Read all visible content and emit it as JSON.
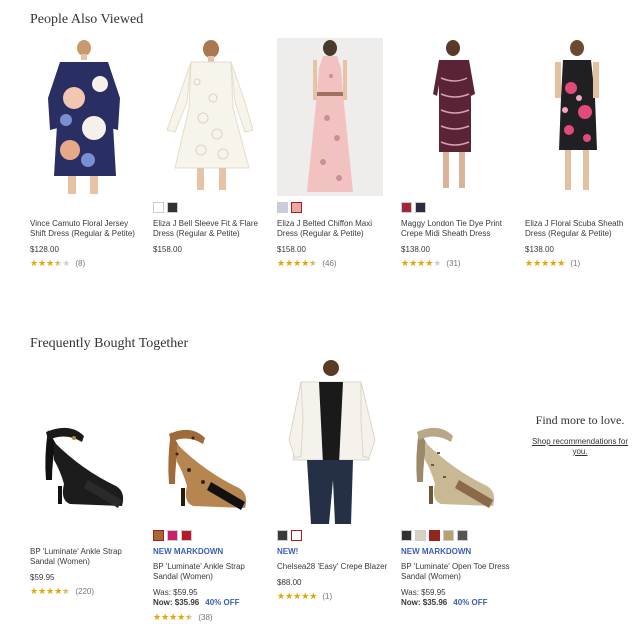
{
  "people_also_viewed": {
    "title": "People Also Viewed",
    "items": [
      {
        "name": "Vince Camuto Floral Jersey Shift Dress (Regular & Petite)",
        "price": "$128.00",
        "rating": 3.5,
        "count": "(8)"
      },
      {
        "name": "Eliza J Bell Sleeve Fit & Flare Dress (Regular & Petite)",
        "price": "$158.00",
        "swatches": [
          "#ffffff",
          "#333333"
        ]
      },
      {
        "name": "Eliza J Belted Chiffon Maxi Dress (Regular & Petite)",
        "price": "$158.00",
        "rating": 4.5,
        "count": "(46)",
        "swatches": [
          "#c8cde0",
          "#e8a8a8"
        ]
      },
      {
        "name": "Maggy London Tie Dye Print Crepe Midi Sheath Dress",
        "price": "$138.00",
        "rating": 4,
        "count": "(31)",
        "swatches": [
          "#a3243b",
          "#2c2c40"
        ]
      },
      {
        "name": "Eliza J Floral Scuba Sheath Dress (Regular & Petite)",
        "price": "$138.00",
        "rating": 5,
        "count": "(1)"
      }
    ]
  },
  "frequently_bought_together": {
    "title": "Frequently Bought Together",
    "items": [
      {
        "name": "BP 'Luminate' Ankle Strap Sandal (Women)",
        "price": "$59.95",
        "rating": 4.5,
        "count": "(220)"
      },
      {
        "badge": "NEW MARKDOWN",
        "name": "BP 'Luminate' Ankle Strap Sandal (Women)",
        "was": "Was: $59.95",
        "now": "Now: $35.96",
        "off": "40% OFF",
        "rating": 4.5,
        "count": "(38)",
        "swatches": [
          "#a06a3a",
          "#c8236a",
          "#b41c2a"
        ]
      },
      {
        "badge": "NEW!",
        "name": "Chelsea28 'Easy' Crepe Blazer",
        "price": "$88.00",
        "rating": 5,
        "count": "(1)",
        "swatches": [
          "#3a3a3a",
          "#ffffff"
        ]
      },
      {
        "badge": "NEW MARKDOWN",
        "name": "BP 'Luminate' Open Toe Dress Sandal (Women)",
        "was": "Was: $59.95",
        "now": "Now: $35.96",
        "off": "40% OFF",
        "swatches": [
          "#333333",
          "#d8d0c0",
          "#8a2a1a",
          "#b8a070",
          "#555555"
        ]
      }
    ]
  },
  "promo": {
    "heading": "Find more to love.",
    "link": "Shop recommendations for you."
  }
}
